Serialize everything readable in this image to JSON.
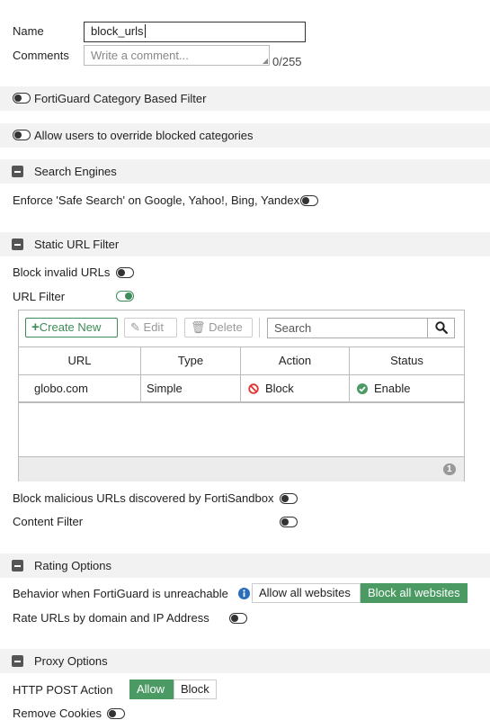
{
  "form": {
    "name_label": "Name",
    "name_value": "block_urls",
    "comments_label": "Comments",
    "comments_placeholder": "Write a comment...",
    "comments_counter": "0/255"
  },
  "sections": {
    "fortiguard_category": "FortiGuard Category Based Filter",
    "allow_override": "Allow users to override blocked categories",
    "search_engines": "Search Engines",
    "static_url_filter": "Static URL Filter",
    "rating_options": "Rating Options",
    "proxy_options": "Proxy Options"
  },
  "search_engines": {
    "safe_search_label": "Enforce 'Safe Search' on Google, Yahoo!, Bing, Yandex"
  },
  "static_url": {
    "block_invalid_label": "Block invalid URLs",
    "url_filter_label": "URL Filter",
    "toolbar": {
      "create_label": "Create New",
      "edit_label": "Edit",
      "delete_label": "Delete",
      "search_placeholder": "Search"
    },
    "columns": [
      "URL",
      "Type",
      "Action",
      "Status"
    ],
    "rows": [
      {
        "url": "globo.com",
        "type": "Simple",
        "action": "Block",
        "status": "Enable"
      }
    ],
    "count": "1",
    "block_malicious_label": "Block malicious URLs discovered by FortiSandbox",
    "content_filter_label": "Content Filter"
  },
  "rating": {
    "behavior_label": "Behavior when FortiGuard is unreachable",
    "allow_all_label": "Allow all websites",
    "block_all_label": "Block all websites",
    "rate_by_domain_label": "Rate URLs by domain and IP Address"
  },
  "proxy": {
    "http_post_label": "HTTP POST Action",
    "allow_label": "Allow",
    "block_label": "Block",
    "remove_cookies_label": "Remove Cookies"
  },
  "colors": {
    "accent_green": "#4b9a63",
    "block_red": "#d33",
    "info_blue": "#2a6ebb"
  },
  "toggles": {
    "fortiguard_category": false,
    "allow_override": false,
    "safe_search": false,
    "block_invalid": false,
    "url_filter": true,
    "block_malicious": false,
    "content_filter": false,
    "rate_by_domain": false,
    "remove_cookies": false
  }
}
